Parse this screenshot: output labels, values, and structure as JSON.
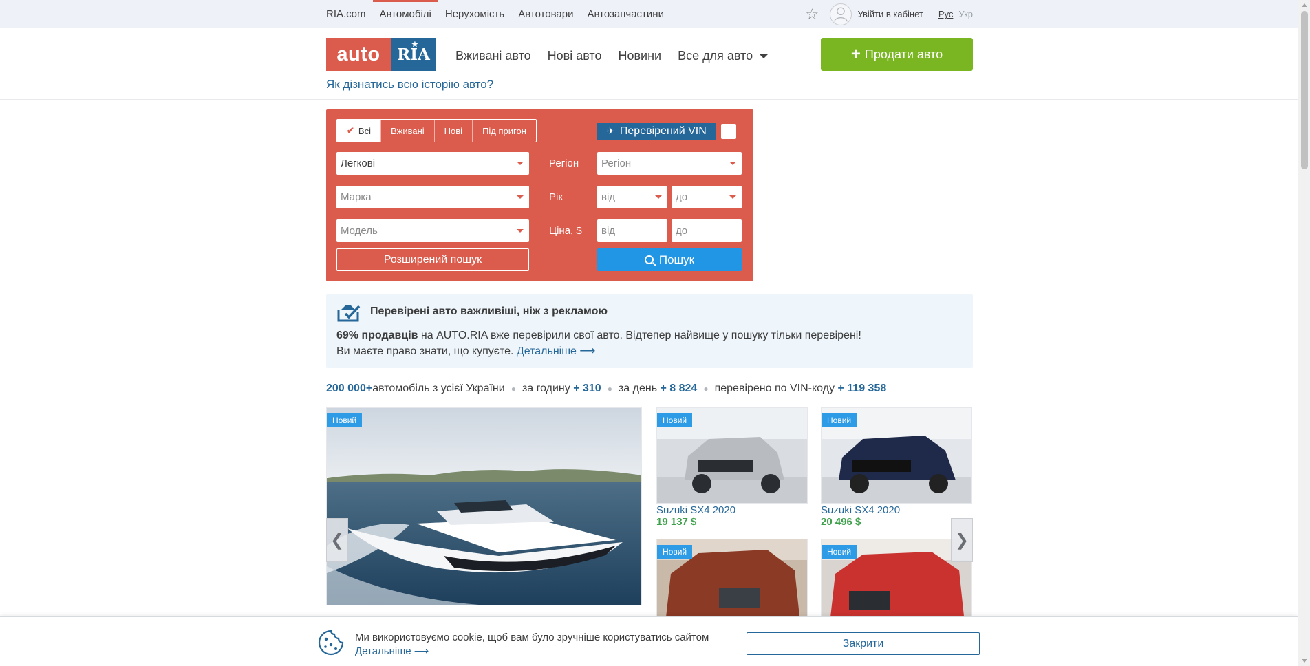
{
  "topbar": {
    "nav": [
      "RIA.com",
      "Автомобілі",
      "Нерухомість",
      "Автотовари",
      "Автозапчастини"
    ],
    "login": "Увійти в кабінет",
    "lang_active": "Рус",
    "lang_inactive": "Укр"
  },
  "header": {
    "logo_left": "auto",
    "logo_right": "RIA",
    "nav": [
      "Вживані авто",
      "Нові авто",
      "Новини",
      "Все для авто"
    ],
    "sell_button": "Продати авто",
    "history_link": "Як дізнатись всю історію авто?"
  },
  "search": {
    "tabs": [
      "Всі",
      "Вживані",
      "Нові",
      "Під пригон"
    ],
    "vin_label": "Перевірений VIN",
    "type_value": "Легкові",
    "brand_placeholder": "Марка",
    "model_placeholder": "Модель",
    "region_label": "Регіон",
    "region_placeholder": "Регіон",
    "year_label": "Рік",
    "year_from": "від",
    "year_to": "до",
    "price_label": "Ціна, $",
    "price_from": "від",
    "price_to": "до",
    "extended_button": "Розширений пошук",
    "search_button": "Пошук"
  },
  "info": {
    "title": "Перевірені авто важливіші, ніж з рекламою",
    "line1_bold": "69% продавців",
    "line1_rest": " на AUTO.RIA вже перевірили свої авто. Відтепер найвище у пошуку тільки перевірені!",
    "line2": "Ви маєте право знати, що купуєте. ",
    "line2_link": "Детальніше ⟶"
  },
  "stats": {
    "total": "200 000+",
    "total_text": " автомобіль з усієї України",
    "hour_label": "за годину",
    "hour_value": "+ 310",
    "day_label": "за день",
    "day_value": "+ 8 824",
    "vin_label": "перевірено по VIN-коду",
    "vin_value": "+ 119 358"
  },
  "listings": {
    "badge": "Новий",
    "prev": "❮",
    "next": "❯",
    "cards": [
      {
        "title": "Suzuki SX4 2020",
        "price": "19 137 $",
        "color": "#b8bcc1"
      },
      {
        "title": "Suzuki SX4 2020",
        "price": "20 496 $",
        "color": "#1f2a4a"
      },
      {
        "title": "",
        "price": "",
        "color": "#8b3a25"
      },
      {
        "title": "",
        "price": "",
        "color": "#c9322e"
      }
    ]
  },
  "cookie": {
    "message": "Ми використовуємо cookie, щоб вам було зручніше користуватись сайтом",
    "more": "Детальніше ⟶",
    "close": "Закрити"
  },
  "colors": {
    "brand_red": "#db5c4c",
    "brand_blue": "#256799",
    "sell_green": "#79b622",
    "search_blue": "#2196e5",
    "price_green": "#3da04a"
  }
}
